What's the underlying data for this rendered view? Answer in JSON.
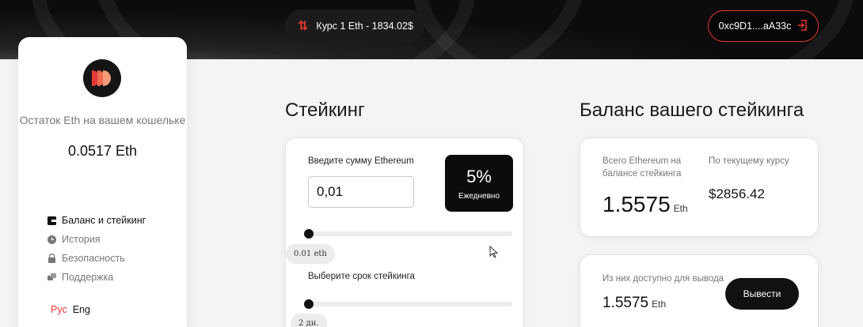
{
  "header": {
    "rate_text": "Курс 1 Eth - 1834.02$",
    "wallet_address": "0xc9D1....aA33c"
  },
  "sidebar": {
    "balance_caption": "Остаток Eth на вашем кошельке",
    "balance_value": "0.0517 Eth",
    "items": [
      {
        "label": "Баланс и стейкинг",
        "icon": "wallet-icon",
        "active": true
      },
      {
        "label": "История",
        "icon": "clock-icon",
        "active": false
      },
      {
        "label": "Безопасность",
        "icon": "lock-icon",
        "active": false
      },
      {
        "label": "Поддержка",
        "icon": "support-icon",
        "active": false
      }
    ],
    "lang": {
      "ru": "Рус",
      "en": "Eng"
    }
  },
  "staking": {
    "title": "Стейкинг",
    "amount_label": "Введите сумму Ethereum",
    "amount_value": "0,01",
    "percent": "5%",
    "period_label": "Ежедневно",
    "amount_slider_value": "0.01 eth",
    "term_label": "Выберите срок стейкинга",
    "term_slider_value": "2 дн."
  },
  "balance": {
    "title": "Баланс вашего стейкинга",
    "total_caption": "Всего Ethereum на балансе стейкинга",
    "total_value": "1.5575",
    "unit": "Eth",
    "usd_caption": "По текущему курсу",
    "usd_value": "$2856.42",
    "available_caption": "Из них доступно для вывода",
    "available_value": "1.5575",
    "withdraw_label": "Вывести"
  },
  "colors": {
    "accent": "#e53935",
    "dark": "#111111"
  }
}
